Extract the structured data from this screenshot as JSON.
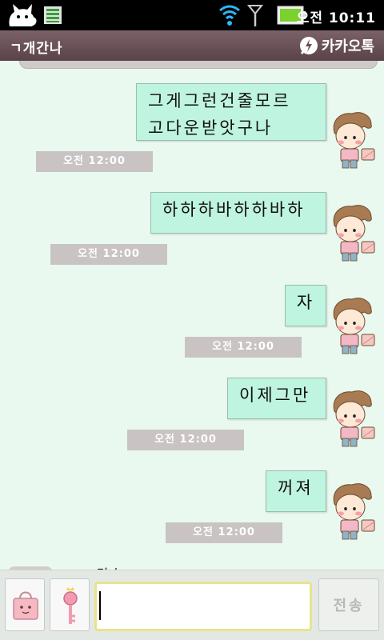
{
  "status_bar": {
    "time": "오전 10:11",
    "icons": [
      "cat-icon",
      "sim-icon",
      "wifi-icon",
      "signal-icon",
      "battery-icon"
    ]
  },
  "header": {
    "chat_title": "ㄱ개간나",
    "brand_label": "카카오톡",
    "brand_icon": "lightning-speech-icon"
  },
  "messages": [
    {
      "lines": [
        "그게그런건줄모르",
        "고다운받앗구나"
      ],
      "time": "오전 12:00"
    },
    {
      "lines": [
        "하하하바하하바하"
      ],
      "time": "오전 12:00"
    },
    {
      "lines": [
        "자"
      ],
      "time": "오전 12:00"
    },
    {
      "lines": [
        "이제그만"
      ],
      "time": "오전 12:00"
    },
    {
      "lines": [
        "꺼져"
      ],
      "time": "오전 12:00"
    }
  ],
  "peek_text": "ㅠ갓ㅣ",
  "input_bar": {
    "left_buttons": [
      "shopping-bag-icon",
      "key-icon"
    ],
    "input_value": "",
    "input_placeholder": "",
    "send_label": "전송"
  },
  "colors": {
    "background": "#e9f9ef",
    "bubble": "#bff4e0",
    "time_chip": "#c9c3c3",
    "title_bar": "#6a5158"
  }
}
